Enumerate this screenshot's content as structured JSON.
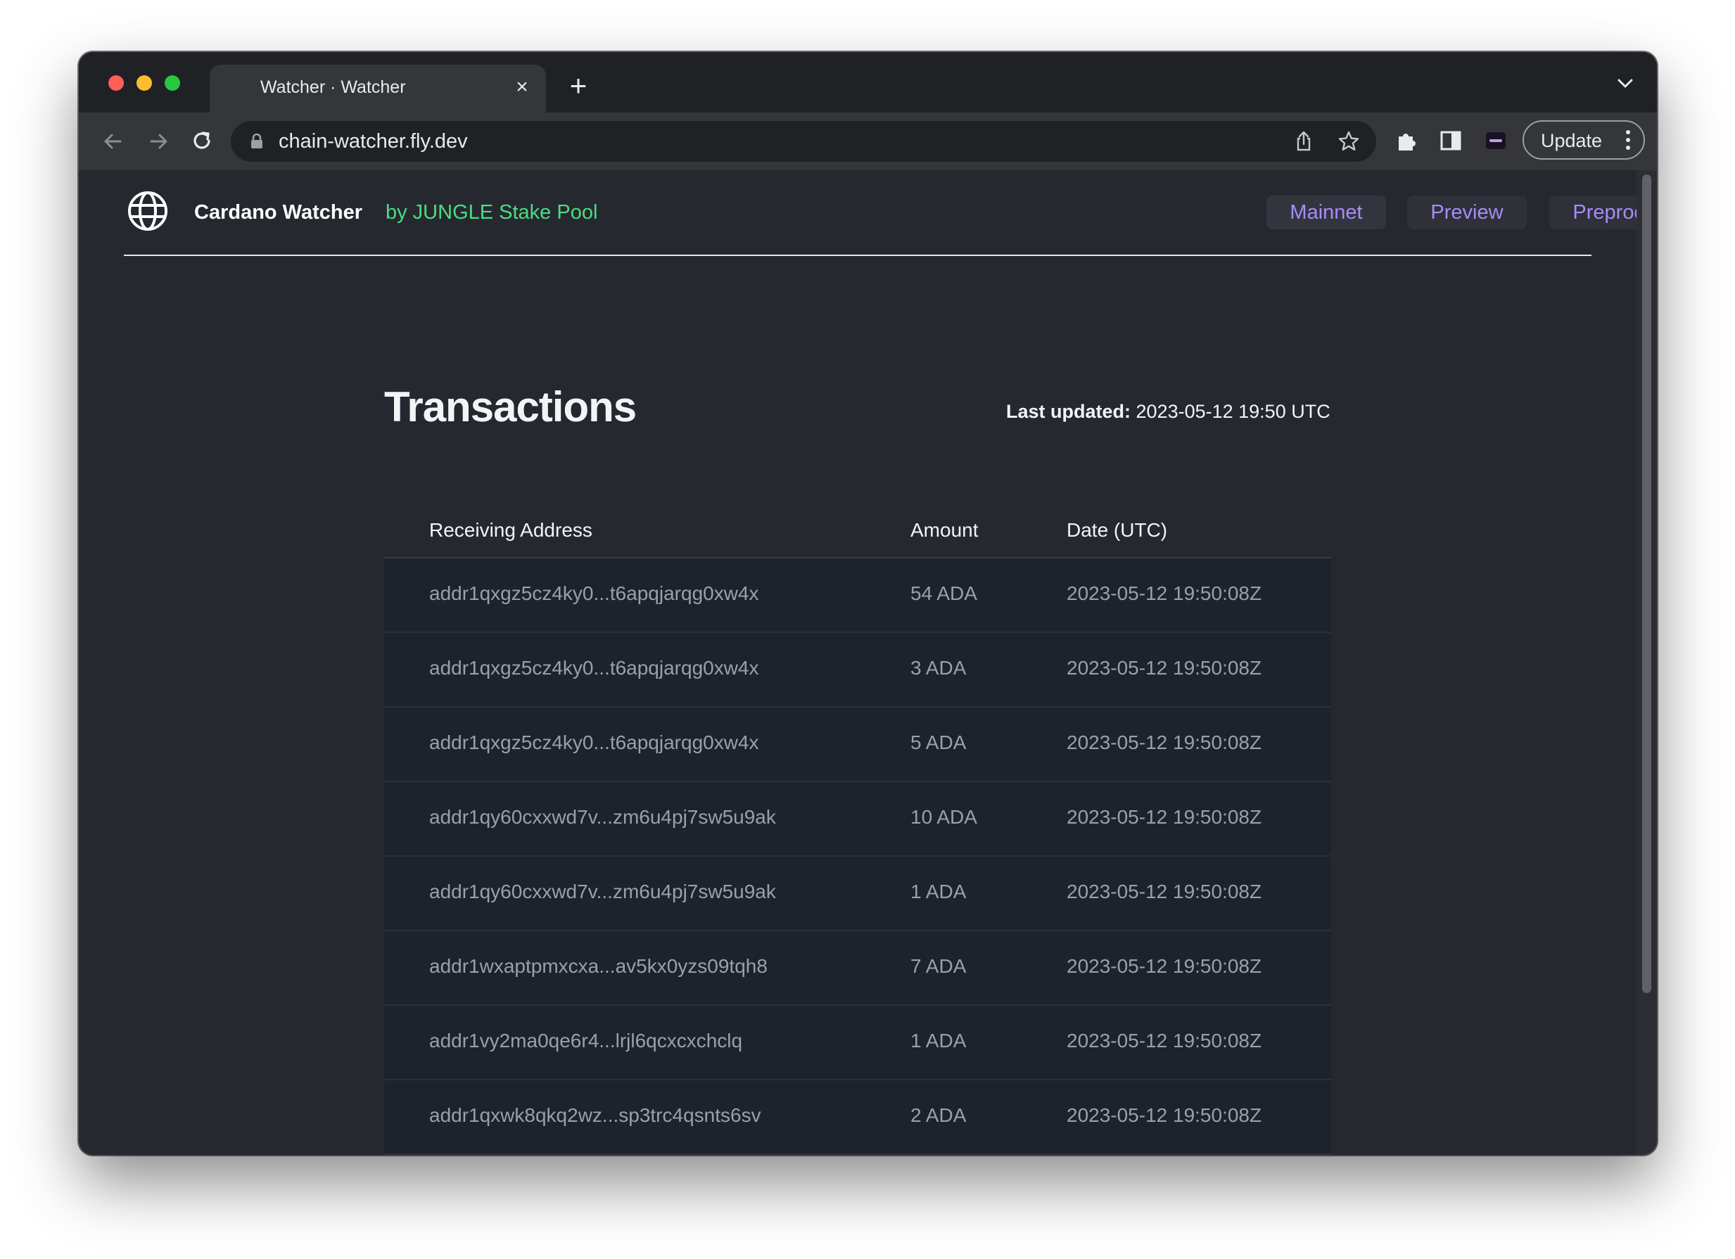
{
  "browser": {
    "tab_title": "Watcher · Watcher",
    "tab_close": "×",
    "new_tab": "+",
    "url": "chain-watcher.fly.dev",
    "update_label": "Update"
  },
  "site": {
    "brand": "Cardano Watcher",
    "by_line": "by JUNGLE Stake Pool",
    "networks": [
      "Mainnet",
      "Preview",
      "Preprod"
    ]
  },
  "page": {
    "title": "Transactions",
    "last_updated_label": "Last updated:",
    "last_updated_value": "2023-05-12 19:50 UTC"
  },
  "table": {
    "columns": [
      "Receiving Address",
      "Amount",
      "Date (UTC)"
    ],
    "rows": [
      [
        "addr1qxgz5cz4ky0...t6apqjarqg0xw4x",
        "54 ADA",
        "2023-05-12 19:50:08Z"
      ],
      [
        "addr1qxgz5cz4ky0...t6apqjarqg0xw4x",
        "3 ADA",
        "2023-05-12 19:50:08Z"
      ],
      [
        "addr1qxgz5cz4ky0...t6apqjarqg0xw4x",
        "5 ADA",
        "2023-05-12 19:50:08Z"
      ],
      [
        "addr1qy60cxxwd7v...zm6u4pj7sw5u9ak",
        "10 ADA",
        "2023-05-12 19:50:08Z"
      ],
      [
        "addr1qy60cxxwd7v...zm6u4pj7sw5u9ak",
        "1 ADA",
        "2023-05-12 19:50:08Z"
      ],
      [
        "addr1wxaptpmxcxa...av5kx0yzs09tqh8",
        "7 ADA",
        "2023-05-12 19:50:08Z"
      ],
      [
        "addr1vy2ma0qe6r4...lrjl6qcxcxchclq",
        "1 ADA",
        "2023-05-12 19:50:08Z"
      ],
      [
        "addr1qxwk8qkq2wz...sp3trc4qsnts6sv",
        "2 ADA",
        "2023-05-12 19:50:08Z"
      ]
    ]
  },
  "colors": {
    "accent_green": "#4ade80",
    "accent_purple": "#a78bfa",
    "background": "#262830",
    "row_background": "#1e222c"
  },
  "icons": [
    "globe-icon",
    "back-icon",
    "forward-icon",
    "reload-icon",
    "lock-icon",
    "share-icon",
    "star-icon",
    "extensions-icon",
    "side-panel-icon",
    "profile-icon",
    "menu-icon",
    "tab-search-icon"
  ]
}
